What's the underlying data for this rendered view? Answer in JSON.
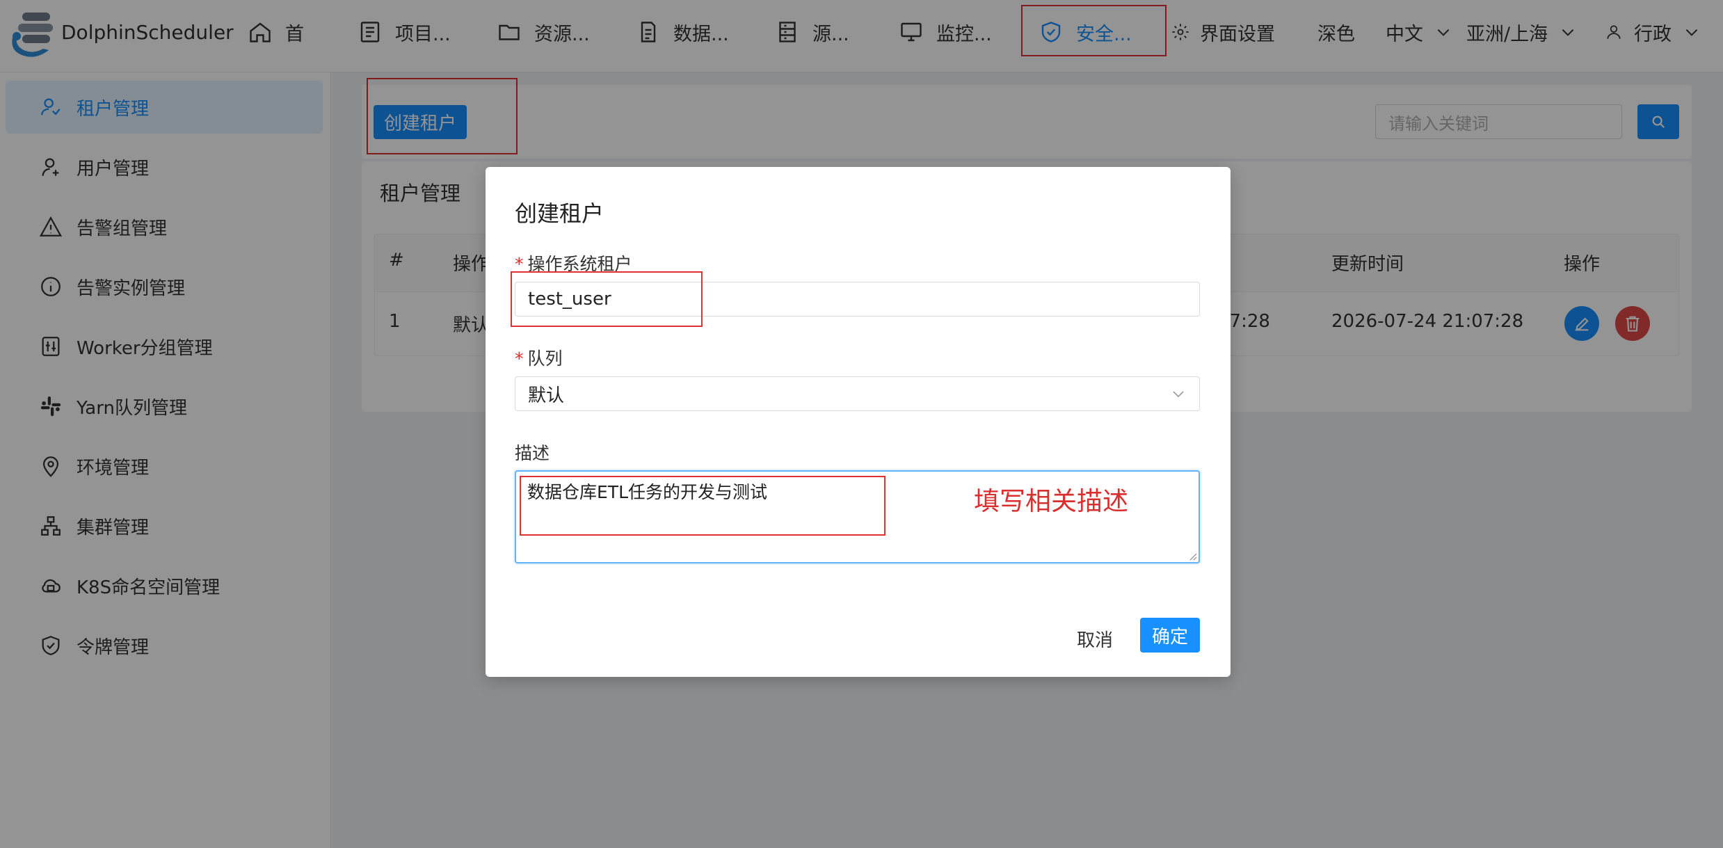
{
  "header": {
    "brand": "DolphinScheduler",
    "nav": [
      {
        "label": "首",
        "icon": "home-icon"
      },
      {
        "label": "项目...",
        "icon": "project-icon"
      },
      {
        "label": "资源...",
        "icon": "folder-icon"
      },
      {
        "label": "数据...",
        "icon": "data-icon"
      },
      {
        "label": "源...",
        "icon": "datasource-icon"
      },
      {
        "label": "监控...",
        "icon": "monitor-icon"
      },
      {
        "label": "安全...",
        "icon": "shield-icon"
      }
    ],
    "ui_settings": "界面设置",
    "theme": "深色",
    "language": "中文",
    "timezone": "亚洲/上海",
    "user": "行政"
  },
  "sidebar": {
    "items": [
      {
        "label": "租户管理",
        "icon": "tenant-icon"
      },
      {
        "label": "用户管理",
        "icon": "user-icon"
      },
      {
        "label": "告警组管理",
        "icon": "warning-icon"
      },
      {
        "label": "告警实例管理",
        "icon": "info-icon"
      },
      {
        "label": "Worker分组管理",
        "icon": "worker-icon"
      },
      {
        "label": "Yarn队列管理",
        "icon": "slack-icon"
      },
      {
        "label": "环境管理",
        "icon": "location-icon"
      },
      {
        "label": "集群管理",
        "icon": "cluster-icon"
      },
      {
        "label": "K8S命名空间管理",
        "icon": "cloud-icon"
      },
      {
        "label": "令牌管理",
        "icon": "token-shield-icon"
      }
    ]
  },
  "toolbar": {
    "create_label": "创建租户",
    "search_placeholder": "请输入关键词"
  },
  "table": {
    "title": "租户管理",
    "headers": {
      "index": "#",
      "op_partial": "操作",
      "updated": "更新时间",
      "actions": "操作"
    },
    "rows": [
      {
        "index": "1",
        "queue_partial": "默认",
        "created_partial": "07:28",
        "updated": "2026-07-24 21:07:28"
      }
    ]
  },
  "modal": {
    "title": "创建租户",
    "tenant_label": "操作系统租户",
    "tenant_value": "test_user",
    "queue_label": "队列",
    "queue_value": "默认",
    "desc_label": "描述",
    "desc_value": "数据仓库ETL任务的开发与测试",
    "annotation": "填写相关描述",
    "cancel": "取消",
    "confirm": "确定"
  },
  "colors": {
    "primary": "#1890ff",
    "danger": "#e04848",
    "highlight": "#e0302f"
  }
}
